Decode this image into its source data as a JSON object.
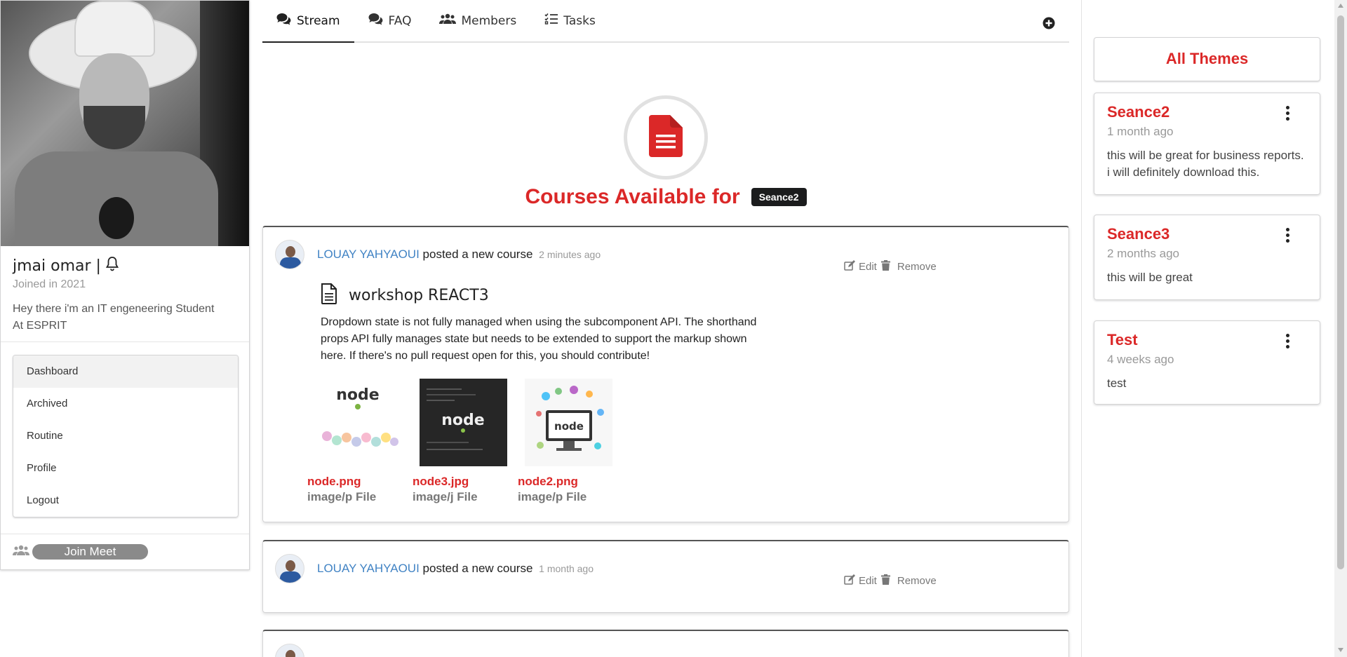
{
  "profile": {
    "name": "jmai omar |",
    "joined": "Joined in 2021",
    "bio": "Hey there i'm an IT engeneering Student At ESPRIT"
  },
  "menu": {
    "items": [
      {
        "label": "Dashboard",
        "active": true
      },
      {
        "label": "Archived"
      },
      {
        "label": "Routine"
      },
      {
        "label": "Profile"
      },
      {
        "label": "Logout"
      }
    ]
  },
  "meet": {
    "label": "Join Meet"
  },
  "tabs": [
    {
      "label": "Stream",
      "icon": "comments-icon",
      "active": true
    },
    {
      "label": "FAQ",
      "icon": "comments-icon"
    },
    {
      "label": "Members",
      "icon": "users-icon"
    },
    {
      "label": "Tasks",
      "icon": "tasks-icon"
    }
  ],
  "header": {
    "title": "Courses Available for",
    "session": "Seance2"
  },
  "posts": [
    {
      "poster": "LOUAY YAHYAOUI",
      "action": "posted a new course",
      "time": "2 minutes ago",
      "edit": "Edit",
      "remove": "Remove",
      "course_title": "workshop REACT3",
      "description": "Dropdown state is not fully managed when using the subcomponent API. The shorthand props API fully manages state but needs to be extended to support the markup shown here. If there's no pull request open for this, you should contribute!",
      "attachments": [
        {
          "name": "node.png",
          "type": "image/p File"
        },
        {
          "name": "node3.jpg",
          "type": "image/j File"
        },
        {
          "name": "node2.png",
          "type": "image/p File"
        }
      ]
    },
    {
      "poster": "LOUAY YAHYAOUI",
      "action": "posted a new course",
      "time": "1 month ago",
      "edit": "Edit",
      "remove": "Remove"
    }
  ],
  "themes": {
    "header": "All Themes",
    "items": [
      {
        "name": "Seance2",
        "time": "1 month ago",
        "desc": "this will be great for business reports. i will definitely download this."
      },
      {
        "name": "Seance3",
        "time": "2 months ago",
        "desc": "this will be great"
      },
      {
        "name": "Test",
        "time": "4 weeks ago",
        "desc": "test"
      }
    ]
  },
  "colors": {
    "accent": "#db2828",
    "link": "#4183c4",
    "badge_bg": "#1b1c1d"
  }
}
